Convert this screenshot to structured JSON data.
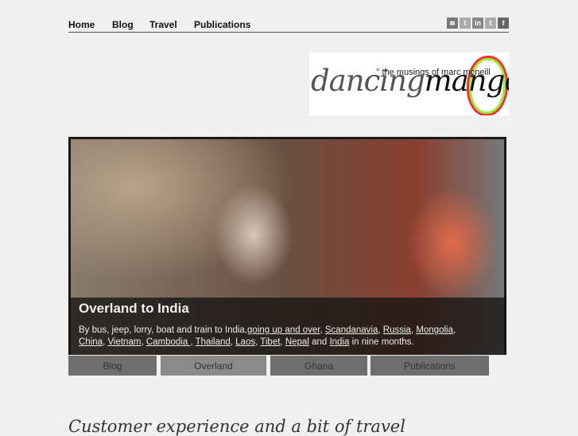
{
  "nav": {
    "items": [
      "Home",
      "Blog",
      "Travel",
      "Publications"
    ]
  },
  "social": [
    {
      "icon": "rss-icon",
      "glyph": "≋"
    },
    {
      "icon": "twitter-icon",
      "glyph": "t"
    },
    {
      "icon": "linkedin-icon",
      "glyph": "in"
    },
    {
      "icon": "twitter-icon",
      "glyph": "t"
    },
    {
      "icon": "facebook-icon",
      "glyph": "f"
    }
  ],
  "logo": {
    "text1": "dancing",
    "text2": "mango",
    "sub": "° the musings of marc mcneill"
  },
  "hero": {
    "title": "Overland to India",
    "intro": "By bus, jeep, lorry, boat and train to India,",
    "links": [
      "going up and over",
      "Scandanavia",
      "Russia",
      "Mongolia",
      "China",
      "Vietnam",
      "Cambodia ",
      "Thailand",
      "Laos",
      "Tibet",
      "Nepal",
      "India"
    ],
    "and": "and",
    "outro": "in nine months."
  },
  "tabs": [
    "Blog",
    "Overland",
    "Ghana",
    "Publications"
  ],
  "tagline": "Customer experience and a bit of travel"
}
